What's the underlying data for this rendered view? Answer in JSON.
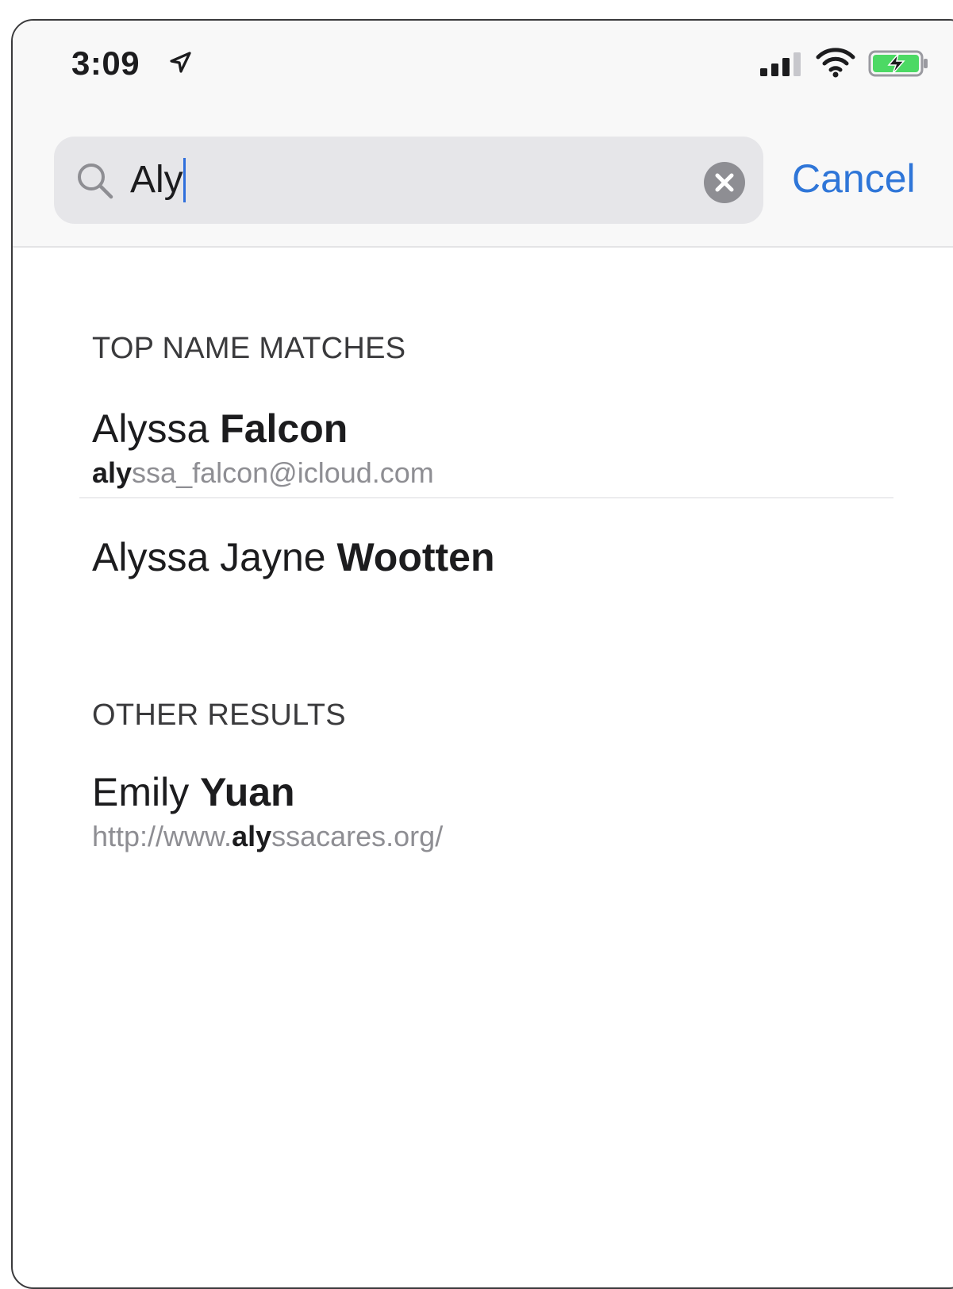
{
  "status_bar": {
    "time": "3:09",
    "location_icon": "location-arrow-icon",
    "signal_icon": "cellular-signal-icon",
    "wifi_icon": "wifi-icon",
    "battery_icon": "battery-charging-icon"
  },
  "search": {
    "query": "Aly",
    "search_icon": "search-icon",
    "clear_icon": "clear-icon",
    "cancel_label": "Cancel"
  },
  "sections": [
    {
      "header": "TOP NAME MATCHES",
      "results": [
        {
          "name_plain": "Alyssa ",
          "name_bold": "Falcon",
          "sub_highlight": "aly",
          "sub_rest": "ssa_falcon@icloud.com"
        },
        {
          "name_plain": "Alyssa Jayne ",
          "name_bold": "Wootten"
        }
      ]
    },
    {
      "header": "OTHER RESULTS",
      "results": [
        {
          "name_plain": "Emily ",
          "name_bold": "Yuan",
          "sub_prefix": "http://www.",
          "sub_highlight": "aly",
          "sub_rest": "ssacares.org/"
        }
      ]
    }
  ],
  "colors": {
    "accent": "#2f76d8",
    "caret": "#2f6fdc",
    "secondary_text": "#8e8e93",
    "search_bg": "#e6e6e9",
    "battery_green": "#4cd964"
  }
}
